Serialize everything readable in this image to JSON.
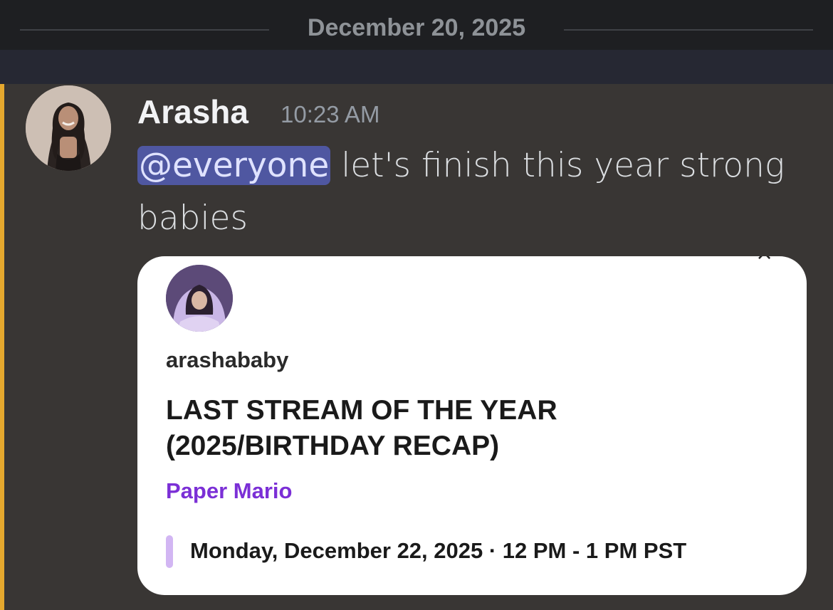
{
  "divider": {
    "date": "December 20, 2025"
  },
  "message": {
    "author": "Arasha",
    "timestamp": "10:23 AM",
    "mention": "@everyone",
    "text": "let's finish this year strong babies",
    "avatar_icon": "user-avatar",
    "accent_color": "#e5a82e",
    "mention_color": "#4f57a1"
  },
  "embed": {
    "avatar_icon": "channel-avatar",
    "close_glyph": "×",
    "channel": "arashababy",
    "title": "LAST STREAM OF THE YEAR (2025/BIRTHDAY RECAP)",
    "game": "Paper Mario",
    "schedule": "Monday, December 22, 2025 · 12 PM - 1 PM PST",
    "game_color": "#7b2fd6",
    "schedule_bar_color": "#d2b6f3"
  }
}
